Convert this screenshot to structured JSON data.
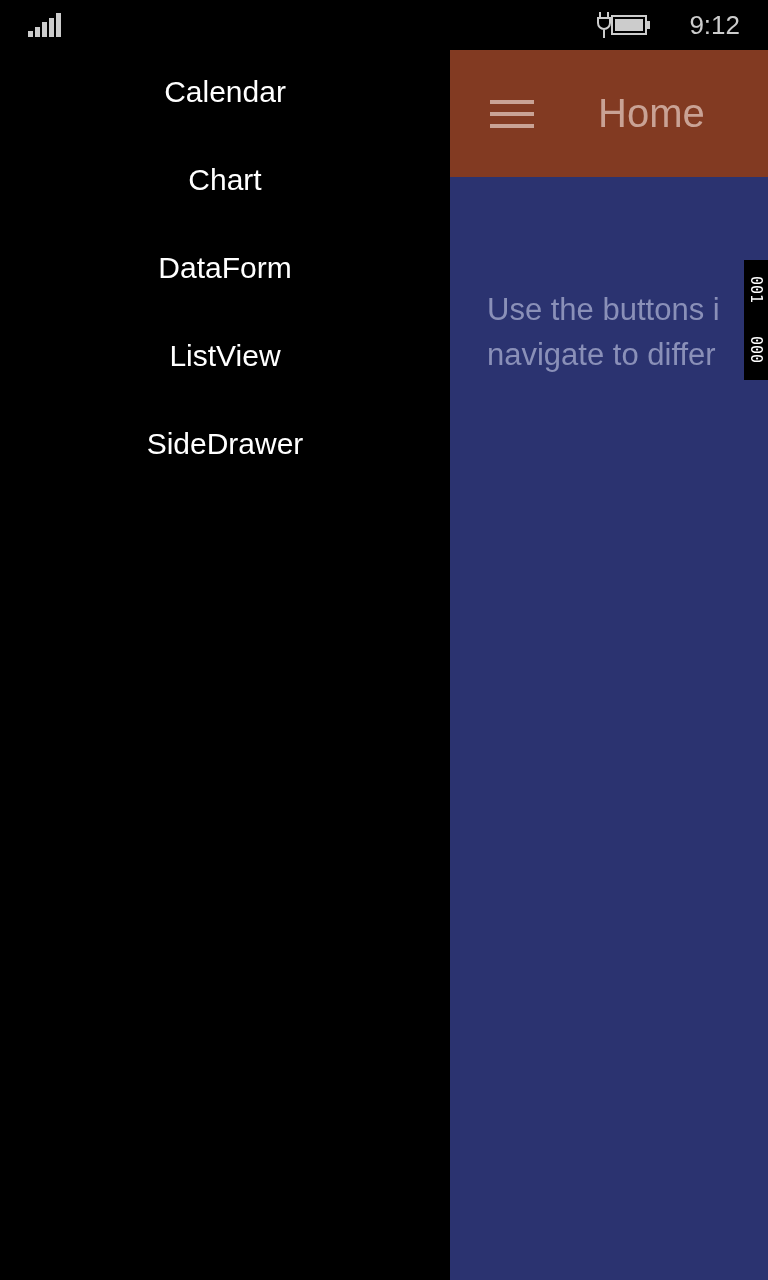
{
  "status_bar": {
    "time": "9:12",
    "charging": true
  },
  "drawer": {
    "items": [
      {
        "label": "Calendar"
      },
      {
        "label": "Chart"
      },
      {
        "label": "DataForm"
      },
      {
        "label": "ListView"
      },
      {
        "label": "SideDrawer"
      }
    ]
  },
  "header": {
    "title": "Home"
  },
  "content": {
    "lines": [
      "Use the buttons i",
      "navigate to differ"
    ]
  },
  "frame_counter": [
    "001",
    "000"
  ]
}
